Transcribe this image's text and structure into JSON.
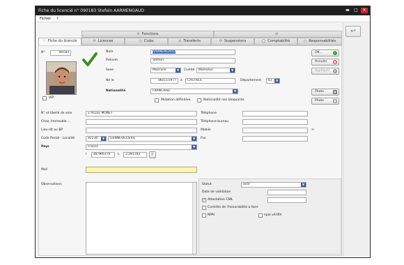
{
  "window": {
    "title": "Fiche du licencié n° 090183 Stefein AARMENGAUD"
  },
  "menu": {
    "fichier": "Fichier",
    "help": "?"
  },
  "tabs_top": [
    {
      "label": "Fonctions",
      "icon": "refresh-icon"
    },
    {
      "label": "",
      "icon": "refresh-icon"
    }
  ],
  "tabs": [
    {
      "label": "Fiche du licencié",
      "active": true
    },
    {
      "label": "Licences"
    },
    {
      "label": "Clubs"
    },
    {
      "label": "Transferts"
    },
    {
      "label": "Suspensions"
    },
    {
      "label": "Comptabilité"
    },
    {
      "label": "Responsabilités"
    }
  ],
  "ident": {
    "n_label": "N°",
    "n_value": "90183",
    "vip_label": "VIP",
    "nom_label": "Nom",
    "nom_value": "AARMENGAUD",
    "prenom_label": "Prénom",
    "prenom_value": "Stefein",
    "sexe_label": "Sexe",
    "sexe_value": "Masculin",
    "civilite_label": "Civilité",
    "civilite_value": "Monsieur",
    "ne_label": "Né le",
    "ne_value": "06/11/1977",
    "a_label": "à",
    "lieu_value": "CASTRES",
    "dept_label": "Département",
    "dept_value": "81",
    "nat_label": "Nationalité",
    "nat_value": "FRANCAISE",
    "mutation_label": "Mutation définitive",
    "nonbloquante_label": "Nationalité non bloquante"
  },
  "buttons": {
    "ok": "OK...",
    "annuler": "Annuler",
    "appliquer": "Appliquer",
    "photo1": "Photo",
    "photo2": "Photo"
  },
  "address": {
    "voie_label": "N° et libellé de voie",
    "voie_value": "2 ALLEE MONET",
    "chez_label": "Chez, Immeuble ...",
    "chez_value": "",
    "lieu_label": "Lieu-dit ou BP",
    "lieu_value": "",
    "cp_label": "Code Postal - Localité",
    "cp_value": "92230",
    "loc_value": "GENNEVILLIERS",
    "pays_label": "Pays",
    "pays_value": "France",
    "l1_label": "l",
    "l1_value": "48,966370",
    "l2_label": "L",
    "l2_value": "2,281342",
    "tel_label": "Téléphone",
    "tel_value": "",
    "telb_label": "Téléphone bureau",
    "telb_value": "",
    "mob_label": "Mobile",
    "mob_value": "",
    "fax_label": "Fax",
    "fax_value": ""
  },
  "mail": {
    "label": "Mail",
    "value": ""
  },
  "obs": {
    "label": "Observations",
    "value": ""
  },
  "status": {
    "statut_label": "Statut",
    "statut_value": "actif",
    "date_label": "Date de validation",
    "attestation_label": "Attestation CNIL",
    "controle_label": "Contrôle de l'honorabilité à faire",
    "npai_label": "NPAI",
    "npai2_label": "npai vérifié"
  },
  "colors": {
    "mail_bg": "#fdf7a8",
    "check": "#3f8f1f",
    "titlebar": "#202020"
  }
}
